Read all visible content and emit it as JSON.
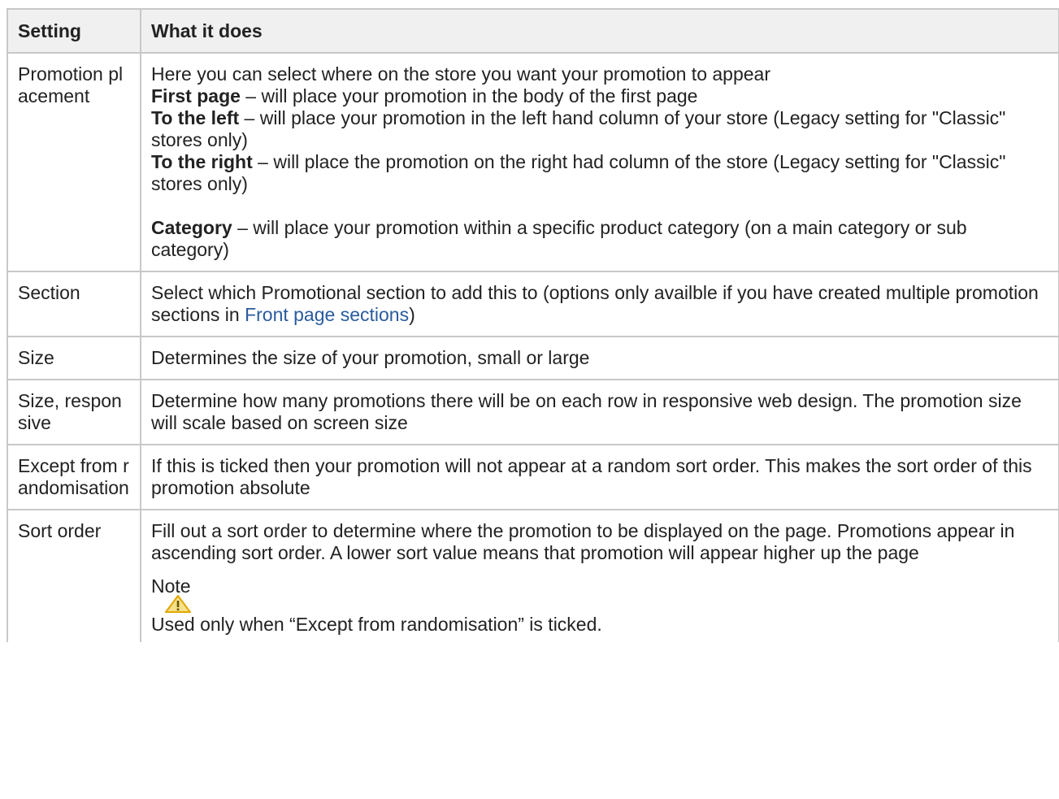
{
  "table": {
    "headers": [
      "Setting",
      "What it does"
    ],
    "rows": {
      "placement": {
        "setting": "Promotion placement",
        "intro": "Here you can select where on the store you want your promotion to appear",
        "options": [
          {
            "label": "First page",
            "text": " – will place your promotion in the body of the first page"
          },
          {
            "label": "To the left",
            "text": " – will place your promotion in the left hand column of your store (Legacy setting for \"Classic\" stores only)"
          },
          {
            "label": "To the right",
            "text": " – will place the promotion on the right had column of the store (Legacy setting for \"Classic\" stores only)"
          },
          {
            "label": "Category",
            "text": " – will place your promotion within a specific product category (on a main category or sub category)"
          }
        ]
      },
      "section": {
        "setting": "Section",
        "text_before": "Select which Promotional section to add this to (options only availble if you have created multiple promotion sections in ",
        "link": "Front page sections",
        "text_after": ")"
      },
      "size": {
        "setting": "Size",
        "text": "Determines the size of your promotion, small or large"
      },
      "size_responsive": {
        "setting": "Size, responsive",
        "text": "Determine how many promotions there will be on each row in responsive web design. The promotion size will scale based on screen size"
      },
      "except": {
        "setting": "Except from randomisation",
        "text": "If this is ticked then your promotion will not appear at a random sort order. This makes the sort order of this promotion absolute"
      },
      "sort_order": {
        "setting": "Sort order",
        "text": "Fill out a sort order to determine where the promotion to be displayed on the page. Promotions appear in ascending sort order. A lower sort value means that promotion will appear higher up the page",
        "note_title": "Note",
        "note_icon": "warning-icon",
        "note_text": "Used only when “Except from randomisation” is ticked."
      }
    }
  },
  "colors": {
    "header_bg": "#f0f0f0",
    "border": "#c8c8c8",
    "link": "#2a5b9e",
    "warning_fill": "#f7e08a",
    "warning_stroke": "#e0a800"
  }
}
